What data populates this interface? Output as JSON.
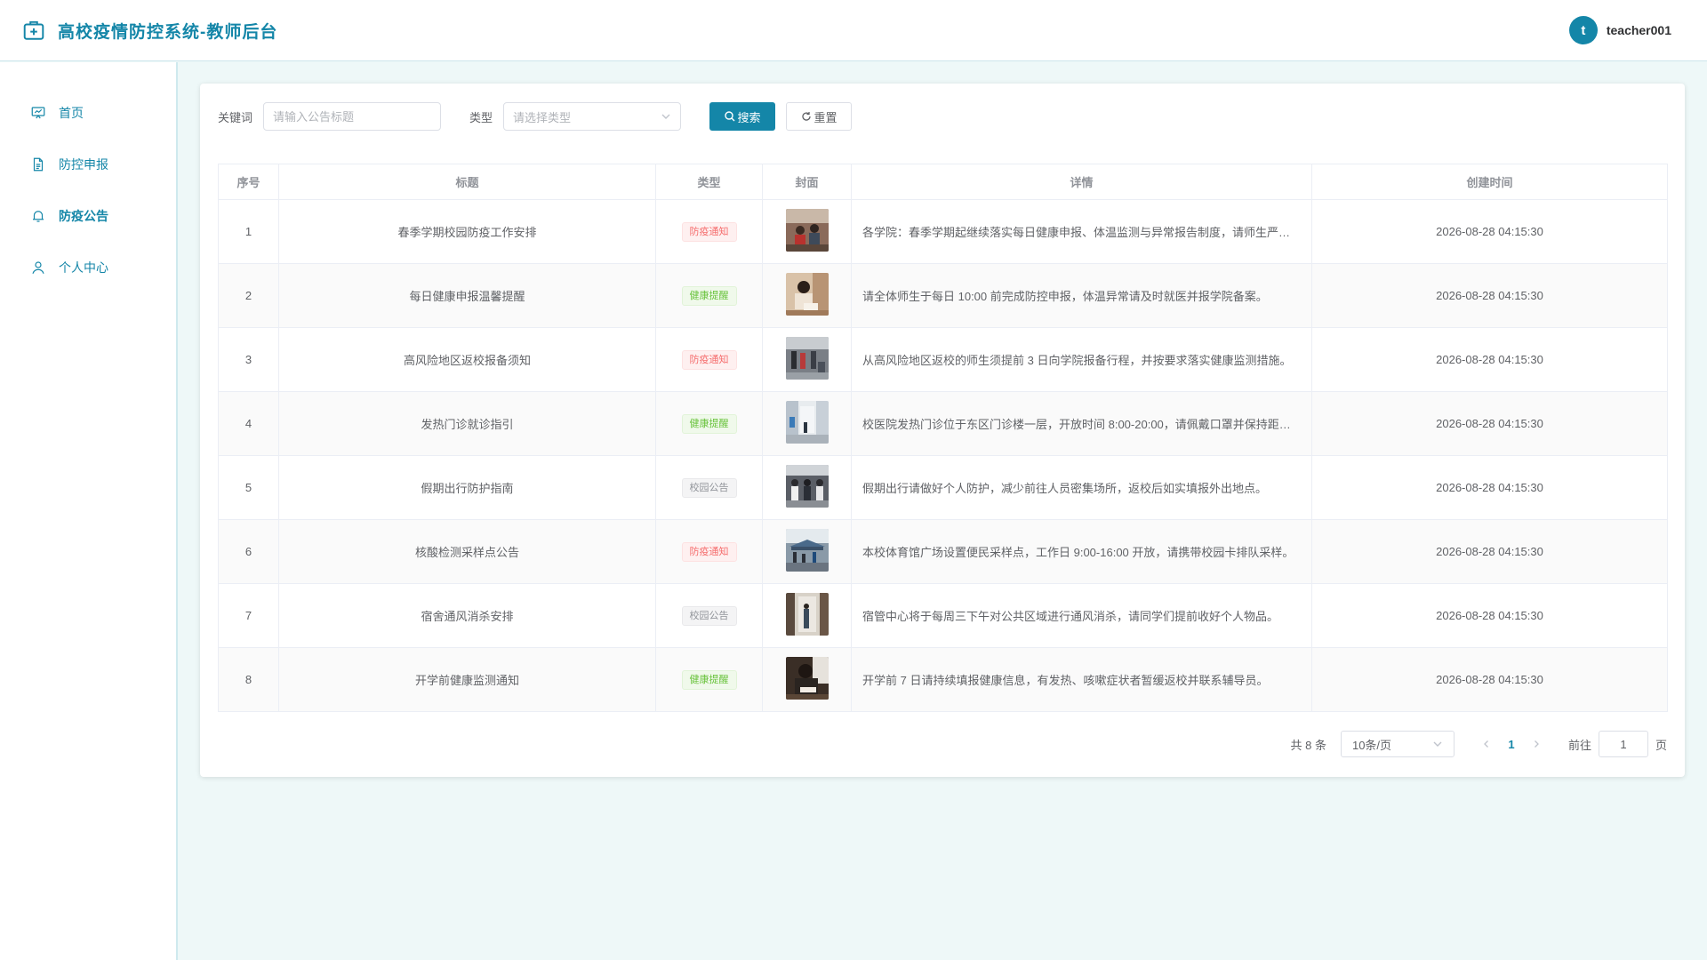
{
  "header": {
    "title": "高校疫情防控系统-教师后台",
    "avatar_letter": "t",
    "username": "teacher001"
  },
  "sidebar": {
    "items": [
      {
        "label": "首页",
        "icon": "dashboard-icon"
      },
      {
        "label": "防控申报",
        "icon": "document-icon"
      },
      {
        "label": "防疫公告",
        "icon": "bell-icon",
        "active": true
      },
      {
        "label": "个人中心",
        "icon": "user-icon"
      }
    ]
  },
  "search": {
    "keyword_label": "关键词",
    "keyword_placeholder": "请输入公告标题",
    "type_label": "类型",
    "type_placeholder": "请选择类型",
    "search_button": "搜索",
    "reset_button": "重置"
  },
  "table": {
    "columns": [
      "序号",
      "标题",
      "类型",
      "封面",
      "详情",
      "创建时间"
    ],
    "rows": [
      {
        "no": "1",
        "title": "春季学期校园防疫工作安排",
        "type": "防疫通知",
        "detail": "各学院：春季学期起继续落实每日健康申报、体温监测与异常报告制度，请师生严格遵守。",
        "time": "2026-08-28 04:15:30"
      },
      {
        "no": "2",
        "title": "每日健康申报温馨提醒",
        "type": "健康提醒",
        "detail": "请全体师生于每日 10:00 前完成防控申报，体温异常请及时就医并报学院备案。",
        "time": "2026-08-28 04:15:30"
      },
      {
        "no": "3",
        "title": "高风险地区返校报备须知",
        "type": "防疫通知",
        "detail": "从高风险地区返校的师生须提前 3 日向学院报备行程，并按要求落实健康监测措施。",
        "time": "2026-08-28 04:15:30"
      },
      {
        "no": "4",
        "title": "发热门诊就诊指引",
        "type": "健康提醒",
        "detail": "校医院发热门诊位于东区门诊楼一层，开放时间 8:00-20:00，请佩戴口罩并保持距离。",
        "time": "2026-08-28 04:15:30"
      },
      {
        "no": "5",
        "title": "假期出行防护指南",
        "type": "校园公告",
        "detail": "假期出行请做好个人防护，减少前往人员密集场所，返校后如实填报外出地点。",
        "time": "2026-08-28 04:15:30"
      },
      {
        "no": "6",
        "title": "核酸检测采样点公告",
        "type": "防疫通知",
        "detail": "本校体育馆广场设置便民采样点，工作日 9:00-16:00 开放，请携带校园卡排队采样。",
        "time": "2026-08-28 04:15:30"
      },
      {
        "no": "7",
        "title": "宿舍通风消杀安排",
        "type": "校园公告",
        "detail": "宿管中心将于每周三下午对公共区域进行通风消杀，请同学们提前收好个人物品。",
        "time": "2026-08-28 04:15:30"
      },
      {
        "no": "8",
        "title": "开学前健康监测通知",
        "type": "健康提醒",
        "detail": "开学前 7 日请持续填报健康信息，有发热、咳嗽症状者暂缓返校并联系辅导员。",
        "time": "2026-08-28 04:15:30"
      }
    ]
  },
  "pagination": {
    "total": "共 8 条",
    "page_size": "10条/页",
    "current": "1",
    "goto_label": "前往",
    "goto_value": "1",
    "page_suffix": "页"
  },
  "colors": {
    "accent": "#1486a8",
    "tag_red": "#f56c6c",
    "tag_green": "#67c23a",
    "tag_gray": "#909399"
  }
}
